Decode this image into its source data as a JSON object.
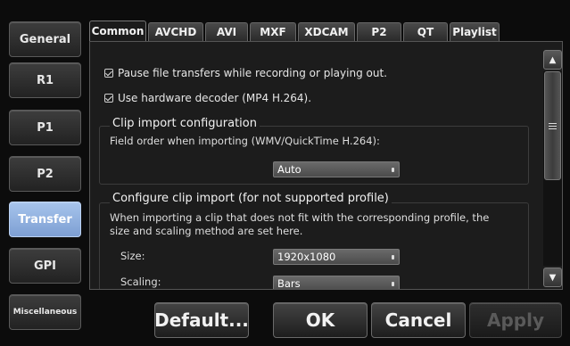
{
  "sidebar": {
    "items": [
      {
        "label": "General"
      },
      {
        "label": "R1"
      },
      {
        "label": "P1"
      },
      {
        "label": "P2"
      },
      {
        "label": "Transfer",
        "active": true
      },
      {
        "label": "GPI"
      },
      {
        "label": "Miscellaneous"
      }
    ]
  },
  "tabs": [
    "Common",
    "AVCHD",
    "AVI",
    "MXF",
    "XDCAM",
    "P2",
    "QT",
    "Playlist"
  ],
  "active_tab": "Common",
  "options": {
    "pause_transfers": {
      "label": "Pause file transfers while recording or playing out.",
      "checked": true
    },
    "hw_decoder": {
      "label": "Use hardware decoder (MP4 H.264).",
      "checked": true
    }
  },
  "clip_import": {
    "title": "Clip import configuration",
    "field_order_label": "Field order when importing (WMV/QuickTime H.264):",
    "field_order_value": "Auto"
  },
  "unsupported": {
    "title": "Configure clip import (for not supported profile)",
    "description": "When importing a clip that does not fit with the corresponding profile, the size and scaling method are set here.",
    "size_label": "Size:",
    "size_value": "1920x1080",
    "scaling_label": "Scaling:",
    "scaling_value": "Bars"
  },
  "buttons": {
    "default": "Default...",
    "ok": "OK",
    "cancel": "Cancel",
    "apply": "Apply"
  },
  "colors": {
    "accent": "#8fb0e0",
    "background": "#0c0c0c",
    "panel": "#1c1c1c"
  }
}
